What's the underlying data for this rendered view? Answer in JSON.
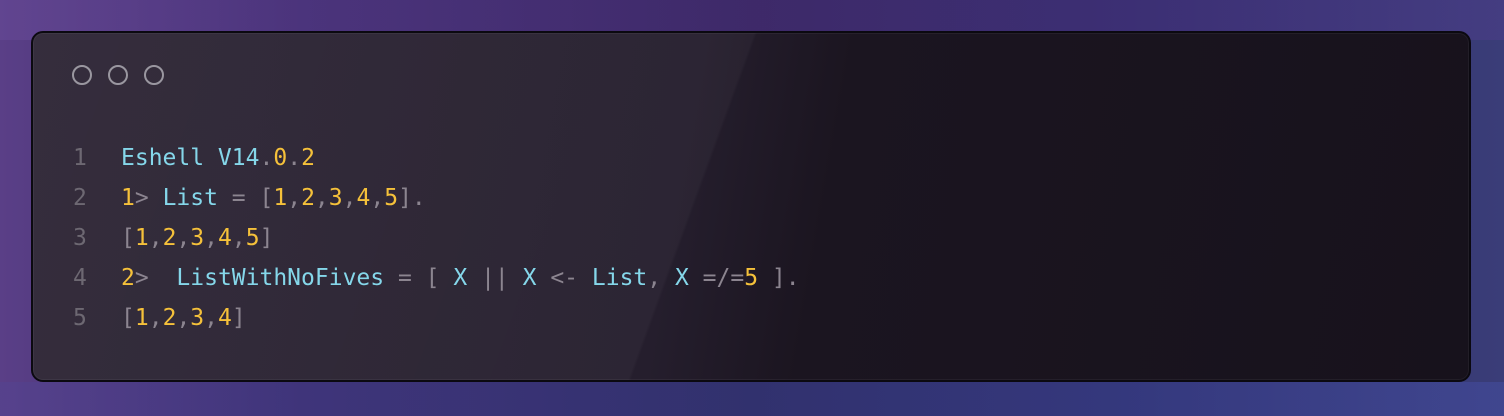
{
  "window": {
    "controls": [
      "close",
      "minimize",
      "maximize"
    ],
    "colors": {
      "identifier": "#85d7ea",
      "number": "#f5c13a",
      "punctuation": "#8c8590",
      "line_number": "#6d6872"
    }
  },
  "code": {
    "lines": [
      {
        "number": "1",
        "tokens": [
          {
            "text": "Eshell V14",
            "kind": "k"
          },
          {
            "text": ".",
            "kind": "p"
          },
          {
            "text": "0",
            "kind": "n"
          },
          {
            "text": ".",
            "kind": "p"
          },
          {
            "text": "2",
            "kind": "n"
          }
        ]
      },
      {
        "number": "2",
        "tokens": [
          {
            "text": "1",
            "kind": "n"
          },
          {
            "text": "> ",
            "kind": "p"
          },
          {
            "text": "List",
            "kind": "k"
          },
          {
            "text": " = [",
            "kind": "p"
          },
          {
            "text": "1",
            "kind": "n"
          },
          {
            "text": ",",
            "kind": "p"
          },
          {
            "text": "2",
            "kind": "n"
          },
          {
            "text": ",",
            "kind": "p"
          },
          {
            "text": "3",
            "kind": "n"
          },
          {
            "text": ",",
            "kind": "p"
          },
          {
            "text": "4",
            "kind": "n"
          },
          {
            "text": ",",
            "kind": "p"
          },
          {
            "text": "5",
            "kind": "n"
          },
          {
            "text": "].",
            "kind": "p"
          }
        ]
      },
      {
        "number": "3",
        "tokens": [
          {
            "text": "[",
            "kind": "p"
          },
          {
            "text": "1",
            "kind": "n"
          },
          {
            "text": ",",
            "kind": "p"
          },
          {
            "text": "2",
            "kind": "n"
          },
          {
            "text": ",",
            "kind": "p"
          },
          {
            "text": "3",
            "kind": "n"
          },
          {
            "text": ",",
            "kind": "p"
          },
          {
            "text": "4",
            "kind": "n"
          },
          {
            "text": ",",
            "kind": "p"
          },
          {
            "text": "5",
            "kind": "n"
          },
          {
            "text": "]",
            "kind": "p"
          }
        ]
      },
      {
        "number": "4",
        "tokens": [
          {
            "text": "2",
            "kind": "n"
          },
          {
            "text": ">  ",
            "kind": "p"
          },
          {
            "text": "ListWithNoFives",
            "kind": "k"
          },
          {
            "text": " = [ ",
            "kind": "p"
          },
          {
            "text": "X",
            "kind": "k"
          },
          {
            "text": " || ",
            "kind": "p"
          },
          {
            "text": "X",
            "kind": "k"
          },
          {
            "text": " <- ",
            "kind": "p"
          },
          {
            "text": "List",
            "kind": "k"
          },
          {
            "text": ", ",
            "kind": "p"
          },
          {
            "text": "X",
            "kind": "k"
          },
          {
            "text": " =/=",
            "kind": "p"
          },
          {
            "text": "5",
            "kind": "n"
          },
          {
            "text": " ].",
            "kind": "p"
          }
        ]
      },
      {
        "number": "5",
        "tokens": [
          {
            "text": "[",
            "kind": "p"
          },
          {
            "text": "1",
            "kind": "n"
          },
          {
            "text": ",",
            "kind": "p"
          },
          {
            "text": "2",
            "kind": "n"
          },
          {
            "text": ",",
            "kind": "p"
          },
          {
            "text": "3",
            "kind": "n"
          },
          {
            "text": ",",
            "kind": "p"
          },
          {
            "text": "4",
            "kind": "n"
          },
          {
            "text": "]",
            "kind": "p"
          }
        ]
      }
    ]
  }
}
